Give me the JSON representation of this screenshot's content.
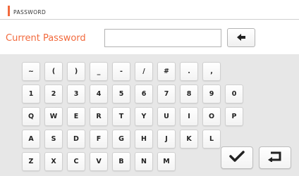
{
  "header": {
    "title": "PASSWORD",
    "accent_color": "#f26a3d"
  },
  "password": {
    "label": "Current Password",
    "value": ""
  },
  "buttons": {
    "backspace_icon": "arrow-left-icon",
    "confirm_icon": "checkmark-icon",
    "back_icon": "return-arrow-icon"
  },
  "keyboard": {
    "rows": [
      [
        "~",
        "(",
        ")",
        "_",
        "-",
        "/",
        "#",
        ".",
        ","
      ],
      [
        "1",
        "2",
        "3",
        "4",
        "5",
        "6",
        "7",
        "8",
        "9",
        "0"
      ],
      [
        "Q",
        "W",
        "E",
        "R",
        "T",
        "Y",
        "U",
        "I",
        "O",
        "P"
      ],
      [
        "A",
        "S",
        "D",
        "F",
        "G",
        "H",
        "J",
        "K",
        "L"
      ],
      [
        "Z",
        "X",
        "C",
        "V",
        "B",
        "N",
        "M"
      ]
    ]
  }
}
